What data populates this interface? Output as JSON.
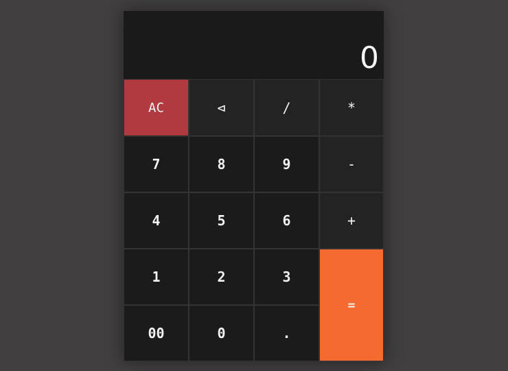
{
  "display": {
    "value": "0"
  },
  "keys": {
    "clear": "AC",
    "backspace": "⊲",
    "divide": "/",
    "multiply": "*",
    "seven": "7",
    "eight": "8",
    "nine": "9",
    "subtract": "-",
    "four": "4",
    "five": "5",
    "six": "6",
    "add": "+",
    "one": "1",
    "two": "2",
    "three": "3",
    "equals": "=",
    "double_zero": "00",
    "zero": "0",
    "decimal": "."
  },
  "colors": {
    "background": "#413f40",
    "clear_key": "#b03a40",
    "equals_key": "#f56a2e",
    "digit_key": "#1b1b1b",
    "operator_key": "#232323"
  },
  "icons": {
    "backspace": "backspace-icon"
  }
}
